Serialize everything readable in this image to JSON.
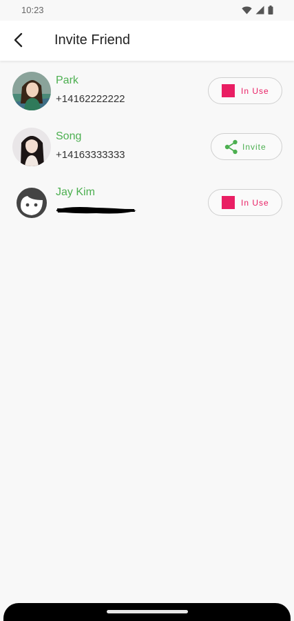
{
  "status_bar": {
    "time": "10:23"
  },
  "app_bar": {
    "title": "Invite Friend"
  },
  "contacts": [
    {
      "name": "Park",
      "phone": "+14162222222",
      "action": "In Use"
    },
    {
      "name": "Song",
      "phone": "+14163333333",
      "action": "Invite"
    },
    {
      "name": "Jay Kim",
      "phone": "",
      "action": "In Use"
    }
  ],
  "colors": {
    "accent_green": "#4caf50",
    "in_use_pink": "#e91e63",
    "background": "#f8f8f8"
  },
  "icons": {
    "back": "arrow-left-icon",
    "share": "share-icon",
    "stop": "stop-square-icon",
    "default_avatar": "face-icon"
  }
}
